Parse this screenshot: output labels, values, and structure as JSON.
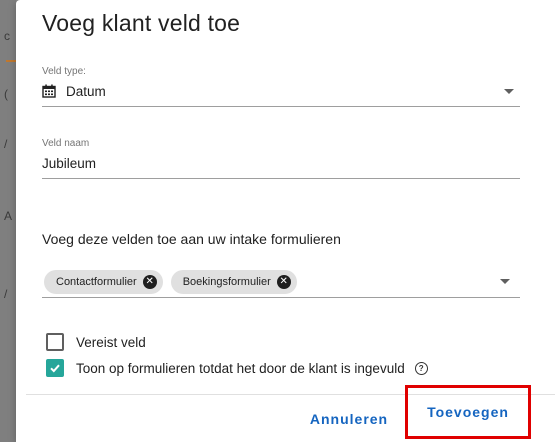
{
  "dialog": {
    "title": "Voeg klant veld toe",
    "field_type": {
      "label": "Veld type:",
      "value": "Datum",
      "icon": "calendar-icon"
    },
    "field_name": {
      "label": "Veld naam",
      "value": "Jubileum"
    },
    "forms_section": {
      "heading": "Voeg deze velden toe aan uw intake formulieren",
      "chips": [
        {
          "label": "Contactformulier",
          "remove_icon": "close-circle-icon"
        },
        {
          "label": "Boekingsformulier",
          "remove_icon": "close-circle-icon"
        }
      ]
    },
    "checkboxes": [
      {
        "label": "Vereist veld",
        "checked": false
      },
      {
        "label": "Toon op formulieren totdat het door de klant is ingevuld",
        "checked": true,
        "help_icon": "help-circle-icon"
      }
    ],
    "actions": {
      "cancel_label": "Annuleren",
      "add_label": "Toevoegen"
    },
    "colors": {
      "accent": "#1565c0",
      "checkbox_checked": "#26a69a",
      "highlight_box": "#e00000"
    }
  }
}
